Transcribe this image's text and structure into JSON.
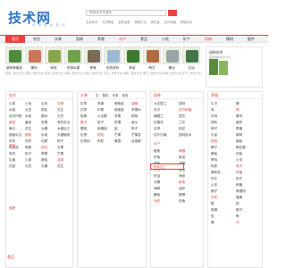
{
  "header": {
    "logo": "技术网",
    "logo_sub": "全 球 技 术 知 识",
    "search_placeholder": "搜索技术关键字",
    "hotkeys": [
      "玉米种子",
      "花卉栽培",
      "招商加盟",
      "移栽方法",
      "病虫害",
      "花卉种植",
      "养殖技术"
    ]
  },
  "nav": [
    {
      "label": "首页",
      "active": true
    },
    {
      "label": "农业"
    },
    {
      "label": "水果"
    },
    {
      "label": "园林"
    },
    {
      "label": "养殖"
    },
    {
      "label": "水产",
      "hl": true
    },
    {
      "label": "食品"
    },
    {
      "label": "小吃"
    },
    {
      "label": "矿产"
    },
    {
      "label": "机械",
      "hl": true
    },
    {
      "label": "模材"
    },
    {
      "label": "配件"
    }
  ],
  "products": [
    {
      "name": "蔬菜种植苗",
      "sub": "蔬菜 | 技术大全",
      "color": "#4e8b3a"
    },
    {
      "name": "猪肉",
      "sub": "养殖 | 技术大全",
      "color": "#c9755a"
    },
    {
      "name": "秋蛟",
      "sub": "养殖 | 技术大全",
      "color": "#8aa64d"
    },
    {
      "name": "热带水果",
      "sub": "水果 | 技术大全",
      "color": "#6da24a"
    },
    {
      "name": "养殖",
      "sub": "养殖 | 技术大全",
      "color": "#7a6a58"
    },
    {
      "name": "农资资料",
      "sub": "农业 | 技术大全",
      "color": "#9bb7d4"
    },
    {
      "name": "种苗",
      "sub": "种苗 | 技术大全",
      "color": "#3e7a2c"
    },
    {
      "name": "陶艺",
      "sub": "陶艺 | 技术大全",
      "color": "#b46a40"
    },
    {
      "name": "螺丝",
      "sub": "机械 | 技术大全",
      "color": "#9aa3a8"
    },
    {
      "name": "石油",
      "sub": "矿产 | 技术大全",
      "color": "#44744a"
    }
  ],
  "adbox": {
    "title": "园林技术",
    "sub": "园林种植技术大全"
  },
  "panels": {
    "p1": {
      "title": "农业",
      "cells": [
        "小麦",
        "小鸡",
        "玉米",
        "甘蔗",
        "水稻",
        "大豆",
        "棉花",
        "花生",
        "经济作物",
        "水稻",
        "果树",
        "大豆",
        "蔬菜",
        "番茄",
        "苹果",
        "有机农业",
        "黄瓜",
        "花生",
        "大棚",
        "木薯加工",
        "超级杂交",
        "蔬菜",
        "水稻",
        "大棚蔬菜",
        "农机",
        "农药",
        "化肥",
        "种子",
        "乳制品",
        "葡萄",
        "西瓜",
        "大葱",
        "有机",
        "桔子",
        "草莓",
        "芒果",
        "生姜",
        "小麦",
        "蔬菜",
        "韭菜",
        "花菜",
        "大豆",
        "大棚",
        "花生"
      ],
      "sub1": "蔬菜",
      "sub2": "施肥"
    },
    "p2": {
      "title": "水果",
      "tabs": [
        "杏",
        "樱桃",
        "苹果",
        "葡萄"
      ],
      "cells": [
        "红枣",
        "苹果",
        "葡萄苗",
        "香蕉",
        "红枣",
        "柠檬",
        "葡萄苗",
        "苹果树",
        "板栗",
        "火龙果",
        "苹果",
        "杨桃",
        "橙子",
        "桃子",
        "柑橘",
        "南瓜",
        "樱桃",
        "猕猴桃",
        "梨",
        "柿子",
        "红枣",
        "荔枝",
        "芒果",
        "芒果苗",
        "红枣树",
        "枸杞",
        "桑葚",
        "百香果"
      ]
    },
    "p3": {
      "title": "园林",
      "cells": [
        "大花蕙兰",
        "园林",
        "花卉",
        "花卉种植",
        "蝴蝶兰",
        "园艺",
        "杜鹃花",
        "兰花",
        "月季",
        "桂花",
        "红叶石楠",
        "园林苗木"
      ],
      "sub": "水产",
      "cells2": [
        "鲍鱼",
        "黄鳝",
        "甲鱼",
        "鱼苗",
        "草鱼",
        "泥鳅",
        "牛蛙",
        "鳗鱼",
        "虾苗",
        "海参",
        "河蟹",
        "鲈鱼",
        "海鲜",
        "龙虾",
        "鳜鱼",
        "螃蟹",
        "对虾",
        "桂鱼"
      ]
    },
    "p4": {
      "title": "养殖",
      "cells": [
        "牛羊",
        "猪",
        "鸡",
        "鸭",
        "肉鸡",
        "蛋鸡",
        "饲料",
        "兽药",
        "鸽子",
        "野猪",
        "孔雀",
        "鹧鸪",
        "蚯蚓",
        "蜈蚣",
        "蝎子",
        "梅花鹿",
        "獭兔",
        "肉兔",
        "野鸡",
        "土鸡",
        "蚂蚱",
        "鸵鸟",
        "黄粉虫",
        "竹鼠",
        "肉牛",
        "奶牛",
        "山羊",
        "种猪",
        "猪仔",
        "养猪场",
        "羊驼",
        "蜜蜂",
        "蚕",
        "狗",
        "狐狸",
        "貉子",
        "蛇",
        "龟",
        "鹿",
        "马"
      ]
    }
  },
  "floatbox": "大米加工",
  "footer": "食品"
}
